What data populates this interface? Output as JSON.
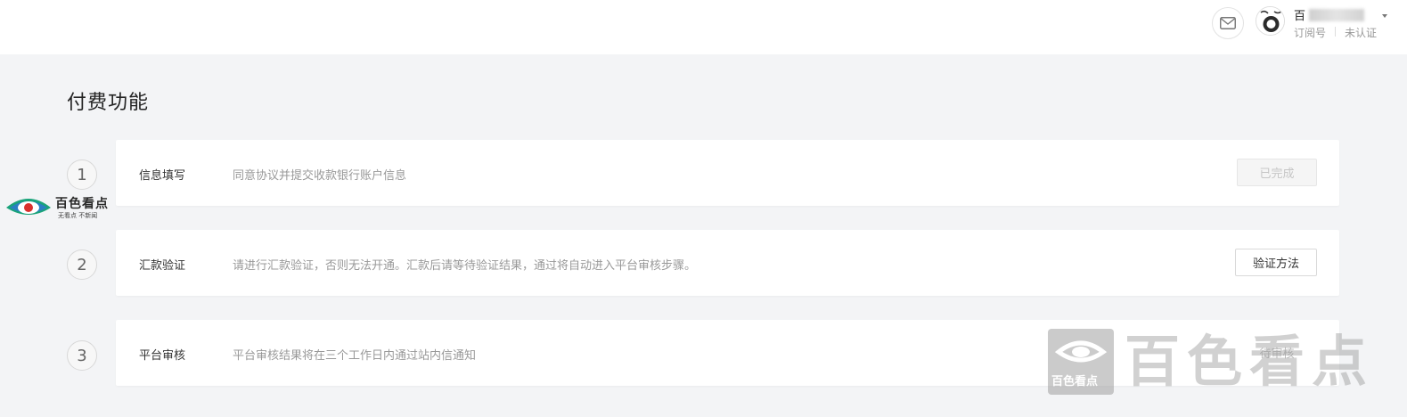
{
  "header": {
    "mail_icon": "mail-icon",
    "account": {
      "name": "百",
      "type": "订阅号",
      "status": "未认证"
    }
  },
  "page": {
    "title": "付费功能"
  },
  "steps": [
    {
      "number": "1",
      "title": "信息填写",
      "description": "同意协议并提交收款银行账户信息",
      "action": "已完成"
    },
    {
      "number": "2",
      "title": "汇款验证",
      "description": "请进行汇款验证，否则无法开通。汇款后请等待验证结果，通过将自动进入平台审核步骤。",
      "action": "验证方法"
    },
    {
      "number": "3",
      "title": "平台审核",
      "description": "平台审核结果将在三个工作日内通过站内信通知",
      "action": "待审核"
    }
  ],
  "watermark": {
    "left_main": "百色看点",
    "left_sub": "无看点 不新闻",
    "right_box": "百色看点",
    "right_text": "百色看点"
  },
  "colors": {
    "page_bg": "#f3f4f6",
    "card_bg": "#ffffff",
    "muted_text": "#999999",
    "logo_green": "#1aa37a",
    "logo_blue": "#2b7fc2",
    "logo_red": "#d9302c"
  }
}
